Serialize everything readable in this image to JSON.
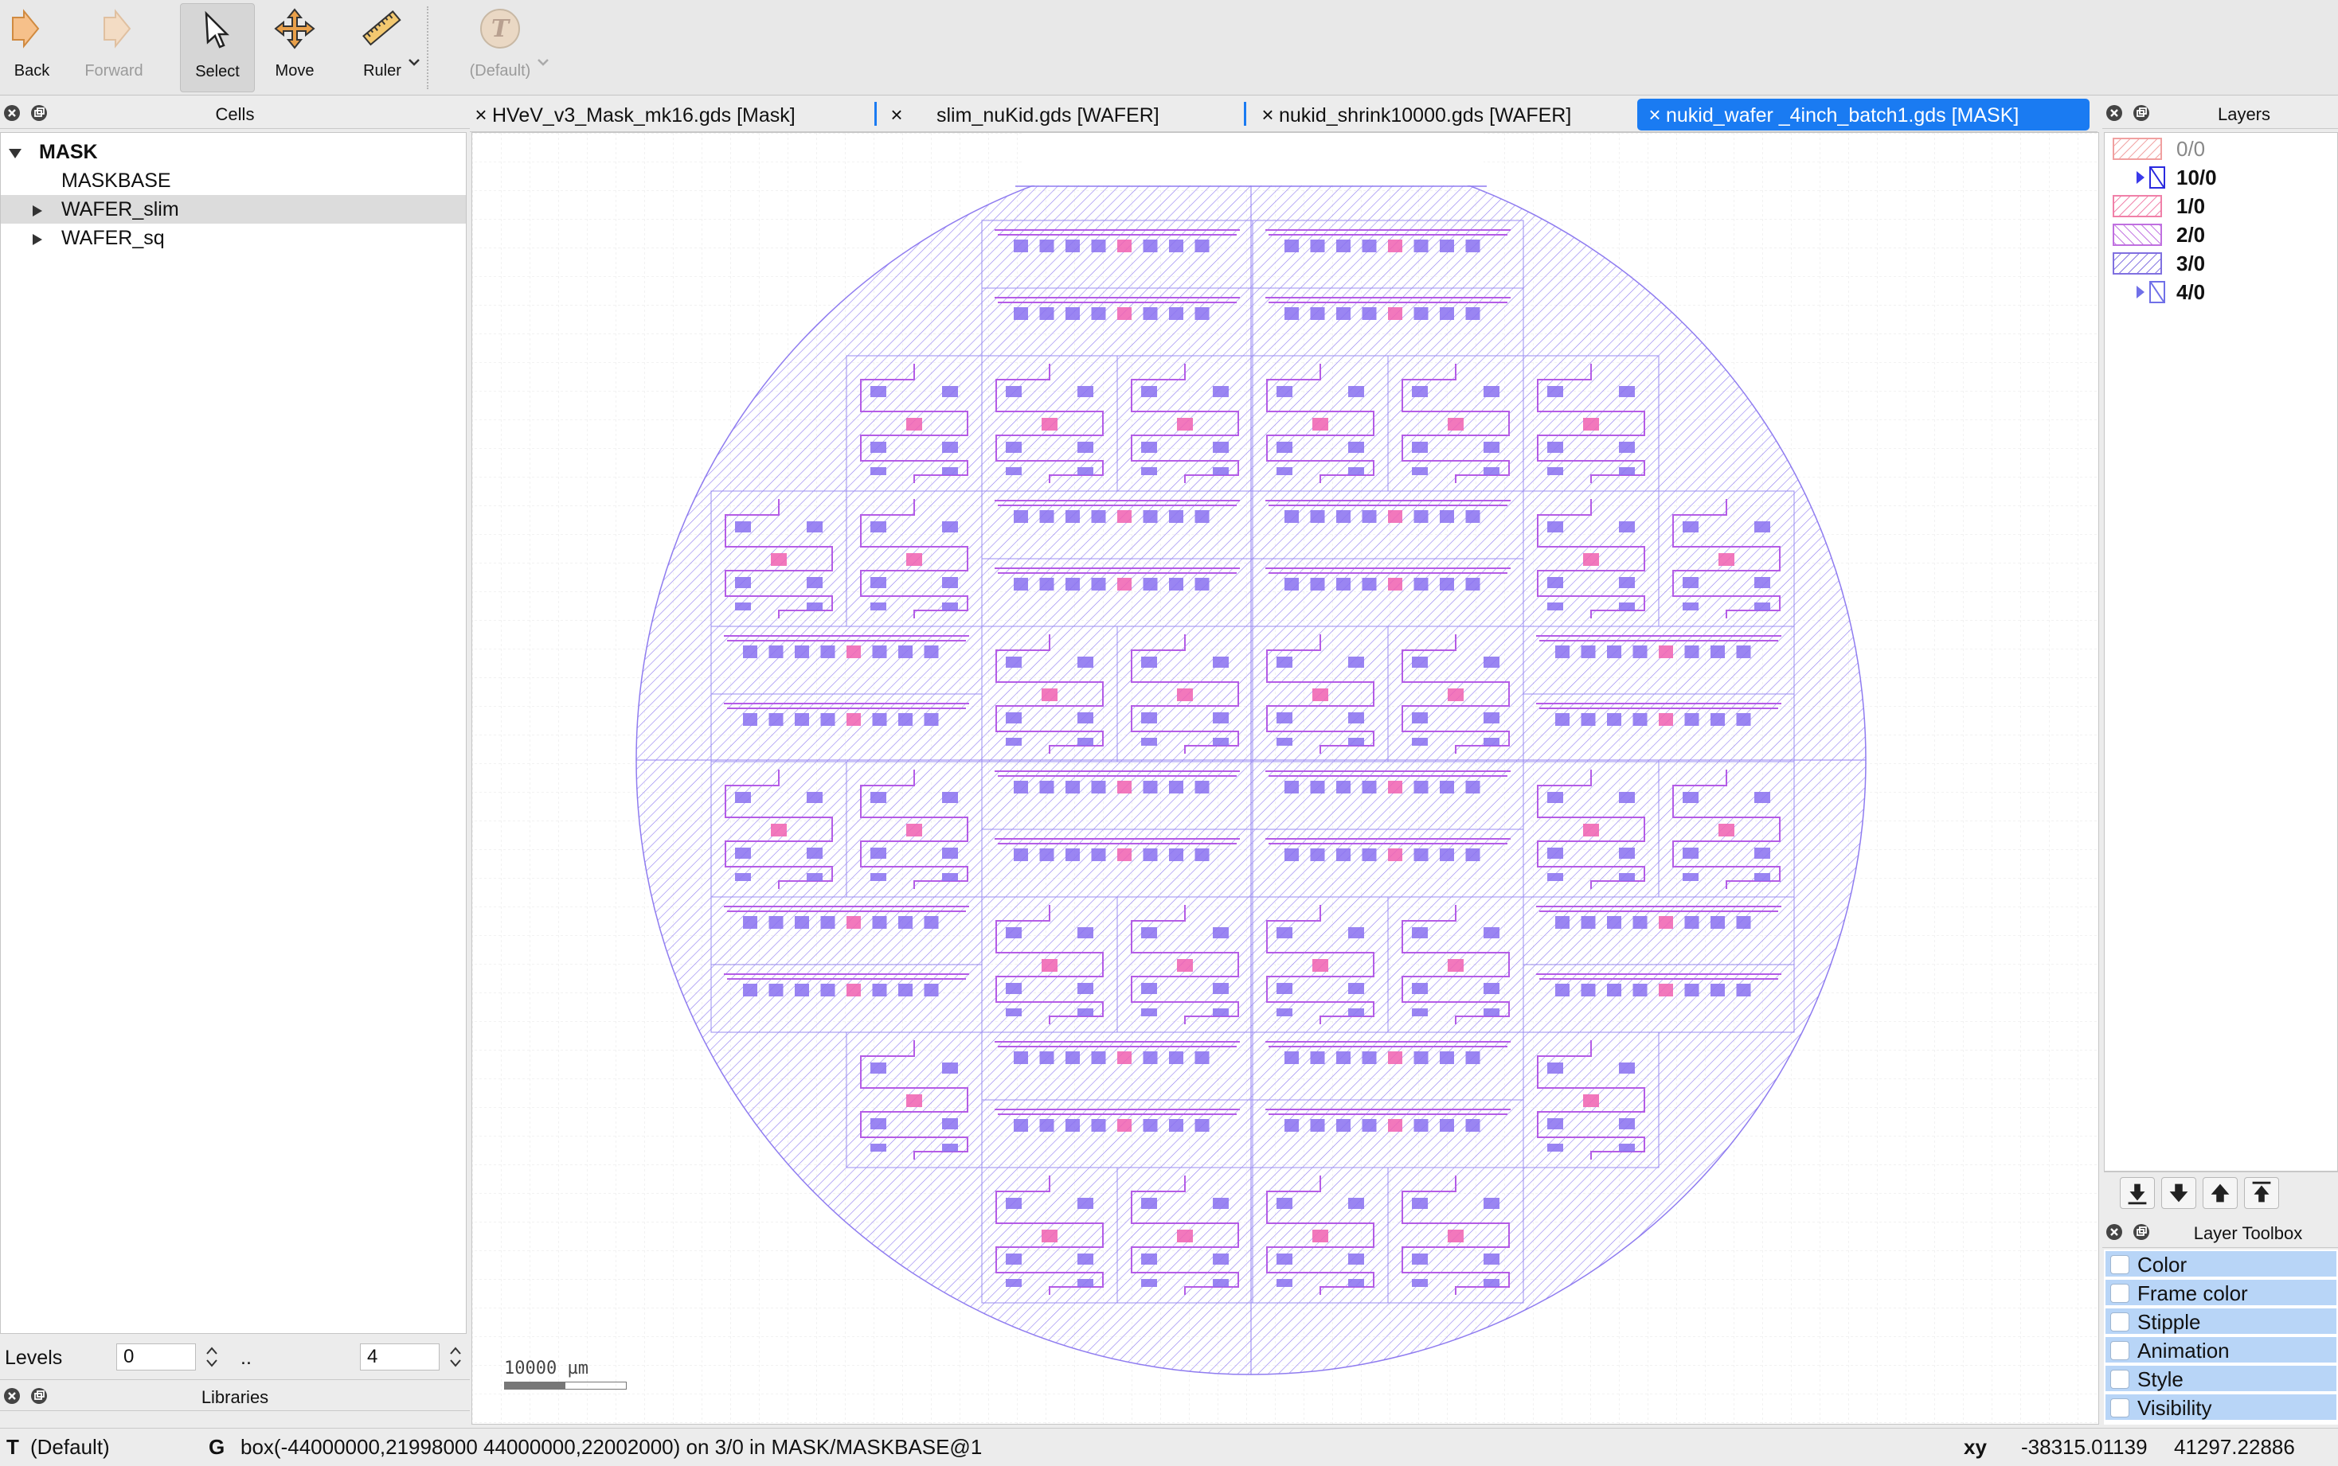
{
  "toolbar": {
    "back": "Back",
    "forward": "Forward",
    "select": "Select",
    "move": "Move",
    "ruler": "Ruler",
    "text_default": "(Default)"
  },
  "cells_panel": {
    "title": "Cells",
    "tree": [
      {
        "label": "MASK",
        "expanded": true
      },
      {
        "label": "MASKBASE"
      },
      {
        "label": "WAFER_slim",
        "selected": true
      },
      {
        "label": "WAFER_sq"
      }
    ]
  },
  "levels": {
    "label": "Levels",
    "from": "0",
    "sep": "..",
    "to": "4"
  },
  "libraries": {
    "title": "Libraries"
  },
  "tabs": [
    {
      "label": "HVeV_v3_Mask_mk16.gds [Mask]"
    },
    {
      "label": "slim_nuKid.gds [WAFER]"
    },
    {
      "label": "nukid_shrink10000.gds [WAFER]"
    },
    {
      "label": "nukid_wafer _4inch_batch1.gds [MASK]",
      "active": true
    }
  ],
  "canvas": {
    "scale_label": "10000 µm",
    "layer_colors": {
      "wafer": "#8f7cf0",
      "trace": "#b45ce6",
      "pad": "#8870f0",
      "center_pad": "#f060b0"
    }
  },
  "layers_panel": {
    "title": "Layers",
    "items": [
      {
        "label": "0/0",
        "color": "#f0a0a0",
        "dim": true
      },
      {
        "label": "10/0",
        "color": "#2a2adf",
        "arrow": true
      },
      {
        "label": "1/0",
        "color": "#f080a8"
      },
      {
        "label": "2/0",
        "color": "#c070e0"
      },
      {
        "label": "3/0",
        "color": "#8070e0"
      },
      {
        "label": "4/0",
        "color": "#7070e8",
        "arrow": true
      }
    ]
  },
  "layer_toolbox": {
    "title": "Layer Toolbox",
    "items": [
      "Color",
      "Frame color",
      "Stipple",
      "Animation",
      "Style",
      "Visibility"
    ]
  },
  "status": {
    "t_key": "T",
    "t_value": "(Default)",
    "g_key": "G",
    "message": "box(-44000000,21998000 44000000,22002000) on 3/0 in MASK/MASKBASE@1",
    "xy_key": "xy",
    "x": "-38315.01139",
    "y": "41297.22886"
  }
}
